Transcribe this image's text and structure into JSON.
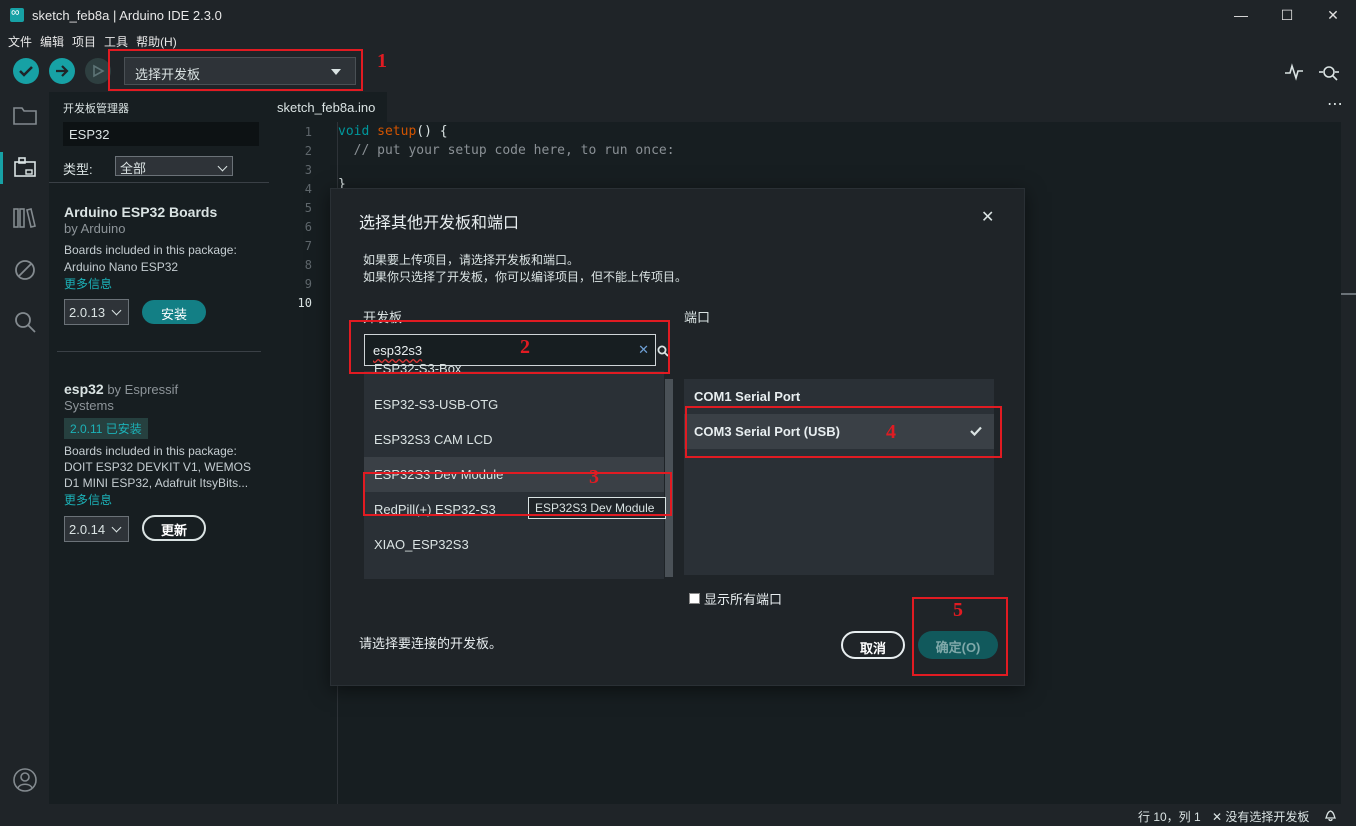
{
  "window": {
    "title": "sketch_feb8a | Arduino IDE 2.3.0",
    "minimize": "—",
    "maximize": "☐",
    "close": "✕"
  },
  "menu": [
    "文件",
    "编辑",
    "项目",
    "工具",
    "帮助(H)"
  ],
  "toolbar": {
    "board_select": "选择开发板"
  },
  "boards_manager": {
    "header": "开发板管理器",
    "search_value": "ESP32",
    "type_label": "类型:",
    "type_value": "全部",
    "packages": [
      {
        "title": "Arduino ESP32 Boards",
        "author": "by Arduino",
        "desc_label": "Boards included in this package:",
        "desc": "Arduino Nano ESP32",
        "more": "更多信息",
        "version": "2.0.13",
        "action": "安装"
      },
      {
        "title": "esp32",
        "author_inline": "by Espressif",
        "author_line2": "Systems",
        "installed_badge": "2.0.11 已安装",
        "desc_label": "Boards included in this package:",
        "desc_line1": "DOIT ESP32 DEVKIT V1, WEMOS",
        "desc_line2": "D1 MINI ESP32, Adafruit ItsyBits...",
        "more": "更多信息",
        "version": "2.0.14",
        "action": "更新"
      }
    ]
  },
  "editor": {
    "tab": "sketch_feb8a.ino",
    "line_numbers": [
      "1",
      "2",
      "3",
      "4",
      "5",
      "6",
      "7",
      "8",
      "9",
      "10"
    ],
    "code_void": "void",
    "code_setup": "setup",
    "code_rest1": "() {",
    "code_comment": "  // put your setup code here, to run once:",
    "code_close": "}"
  },
  "dialog": {
    "title": "选择其他开发板和端口",
    "close": "✕",
    "info_line1": "如果要上传项目，请选择开发板和端口。",
    "info_line2": "如果你只选择了开发板，你可以编译项目，但不能上传项目。",
    "boards_header": "开发板",
    "ports_header": "端口",
    "board_search_value": "esp32s3",
    "boards": [
      "ESP32-S3-Box",
      "ESP32-S3-USB-OTG",
      "ESP32S3 CAM LCD",
      "ESP32S3 Dev Module",
      "RedPill(+) ESP32-S3",
      "XIAO_ESP32S3"
    ],
    "tooltip": "ESP32S3 Dev Module",
    "ports": [
      "COM1 Serial Port",
      "COM3 Serial Port (USB)"
    ],
    "show_all_ports": "显示所有端口",
    "footer_text": "请选择要连接的开发板。",
    "cancel": "取消",
    "ok": "确定(O)"
  },
  "status": {
    "position": "行 10，列 1",
    "board": "没有选择开发板"
  },
  "annotations": [
    "1",
    "2",
    "3",
    "4",
    "5"
  ],
  "colors": {
    "accent": "#17a1a5",
    "annotation": "#e11b22",
    "ok_button": "#11595c"
  }
}
